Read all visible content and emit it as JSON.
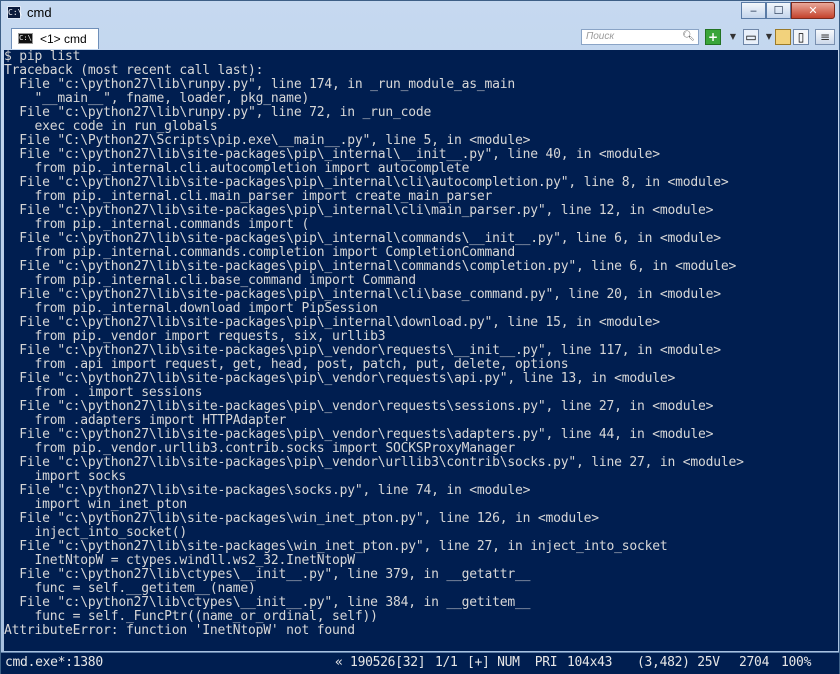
{
  "window": {
    "title": "cmd",
    "app_icon": "C:\\",
    "minimize": "‒",
    "maximize": "☐",
    "close": "✕"
  },
  "toolbar": {
    "tab_icon": "C:\\",
    "tab_label": "<1> cmd",
    "search_placeholder": "Поиск",
    "add_label": "+",
    "dropdown_label": "▼"
  },
  "icons": {
    "search": "search-icon",
    "add": "plus-icon",
    "view": "window-view-icon",
    "lock": "lock-icon",
    "menu": "menu-icon"
  },
  "console": {
    "lines": [
      "$ pip list",
      "Traceback (most recent call last):",
      "  File \"c:\\python27\\lib\\runpy.py\", line 174, in _run_module_as_main",
      "    \"__main__\", fname, loader, pkg_name)",
      "  File \"c:\\python27\\lib\\runpy.py\", line 72, in _run_code",
      "    exec code in run_globals",
      "  File \"C:\\Python27\\Scripts\\pip.exe\\__main__.py\", line 5, in <module>",
      "  File \"c:\\python27\\lib\\site-packages\\pip\\_internal\\__init__.py\", line 40, in <module>",
      "    from pip._internal.cli.autocompletion import autocomplete",
      "  File \"c:\\python27\\lib\\site-packages\\pip\\_internal\\cli\\autocompletion.py\", line 8, in <module>",
      "    from pip._internal.cli.main_parser import create_main_parser",
      "  File \"c:\\python27\\lib\\site-packages\\pip\\_internal\\cli\\main_parser.py\", line 12, in <module>",
      "    from pip._internal.commands import (",
      "  File \"c:\\python27\\lib\\site-packages\\pip\\_internal\\commands\\__init__.py\", line 6, in <module>",
      "    from pip._internal.commands.completion import CompletionCommand",
      "  File \"c:\\python27\\lib\\site-packages\\pip\\_internal\\commands\\completion.py\", line 6, in <module>",
      "    from pip._internal.cli.base_command import Command",
      "  File \"c:\\python27\\lib\\site-packages\\pip\\_internal\\cli\\base_command.py\", line 20, in <module>",
      "    from pip._internal.download import PipSession",
      "  File \"c:\\python27\\lib\\site-packages\\pip\\_internal\\download.py\", line 15, in <module>",
      "    from pip._vendor import requests, six, urllib3",
      "  File \"c:\\python27\\lib\\site-packages\\pip\\_vendor\\requests\\__init__.py\", line 117, in <module>",
      "    from .api import request, get, head, post, patch, put, delete, options",
      "  File \"c:\\python27\\lib\\site-packages\\pip\\_vendor\\requests\\api.py\", line 13, in <module>",
      "    from . import sessions",
      "  File \"c:\\python27\\lib\\site-packages\\pip\\_vendor\\requests\\sessions.py\", line 27, in <module>",
      "    from .adapters import HTTPAdapter",
      "  File \"c:\\python27\\lib\\site-packages\\pip\\_vendor\\requests\\adapters.py\", line 44, in <module>",
      "    from pip._vendor.urllib3.contrib.socks import SOCKSProxyManager",
      "  File \"c:\\python27\\lib\\site-packages\\pip\\_vendor\\urllib3\\contrib\\socks.py\", line 27, in <module>",
      "    import socks",
      "  File \"c:\\python27\\lib\\site-packages\\socks.py\", line 74, in <module>",
      "    import win_inet_pton",
      "  File \"c:\\python27\\lib\\site-packages\\win_inet_pton.py\", line 126, in <module>",
      "    inject_into_socket()",
      "  File \"c:\\python27\\lib\\site-packages\\win_inet_pton.py\", line 27, in inject_into_socket",
      "    InetNtopW = ctypes.windll.ws2_32.InetNtopW",
      "  File \"c:\\python27\\lib\\ctypes\\__init__.py\", line 379, in __getattr__",
      "    func = self.__getitem__(name)",
      "  File \"c:\\python27\\lib\\ctypes\\__init__.py\", line 384, in __getitem__",
      "    func = self._FuncPtr((name_or_ordinal, self))",
      "AttributeError: function 'InetNtopW' not found"
    ]
  },
  "status": {
    "process": "cmd.exe*:1380",
    "position": "« 190526[32]",
    "page": "1/1",
    "mode": "[+] NUM  PRI",
    "size": "104x43",
    "cursor": "(3,482) 25V",
    "pid": "2704",
    "zoom": "100%"
  },
  "colors": {
    "console_bg": "#001e50",
    "console_text": "#d7d7d7",
    "frame": "#a7c0df"
  }
}
